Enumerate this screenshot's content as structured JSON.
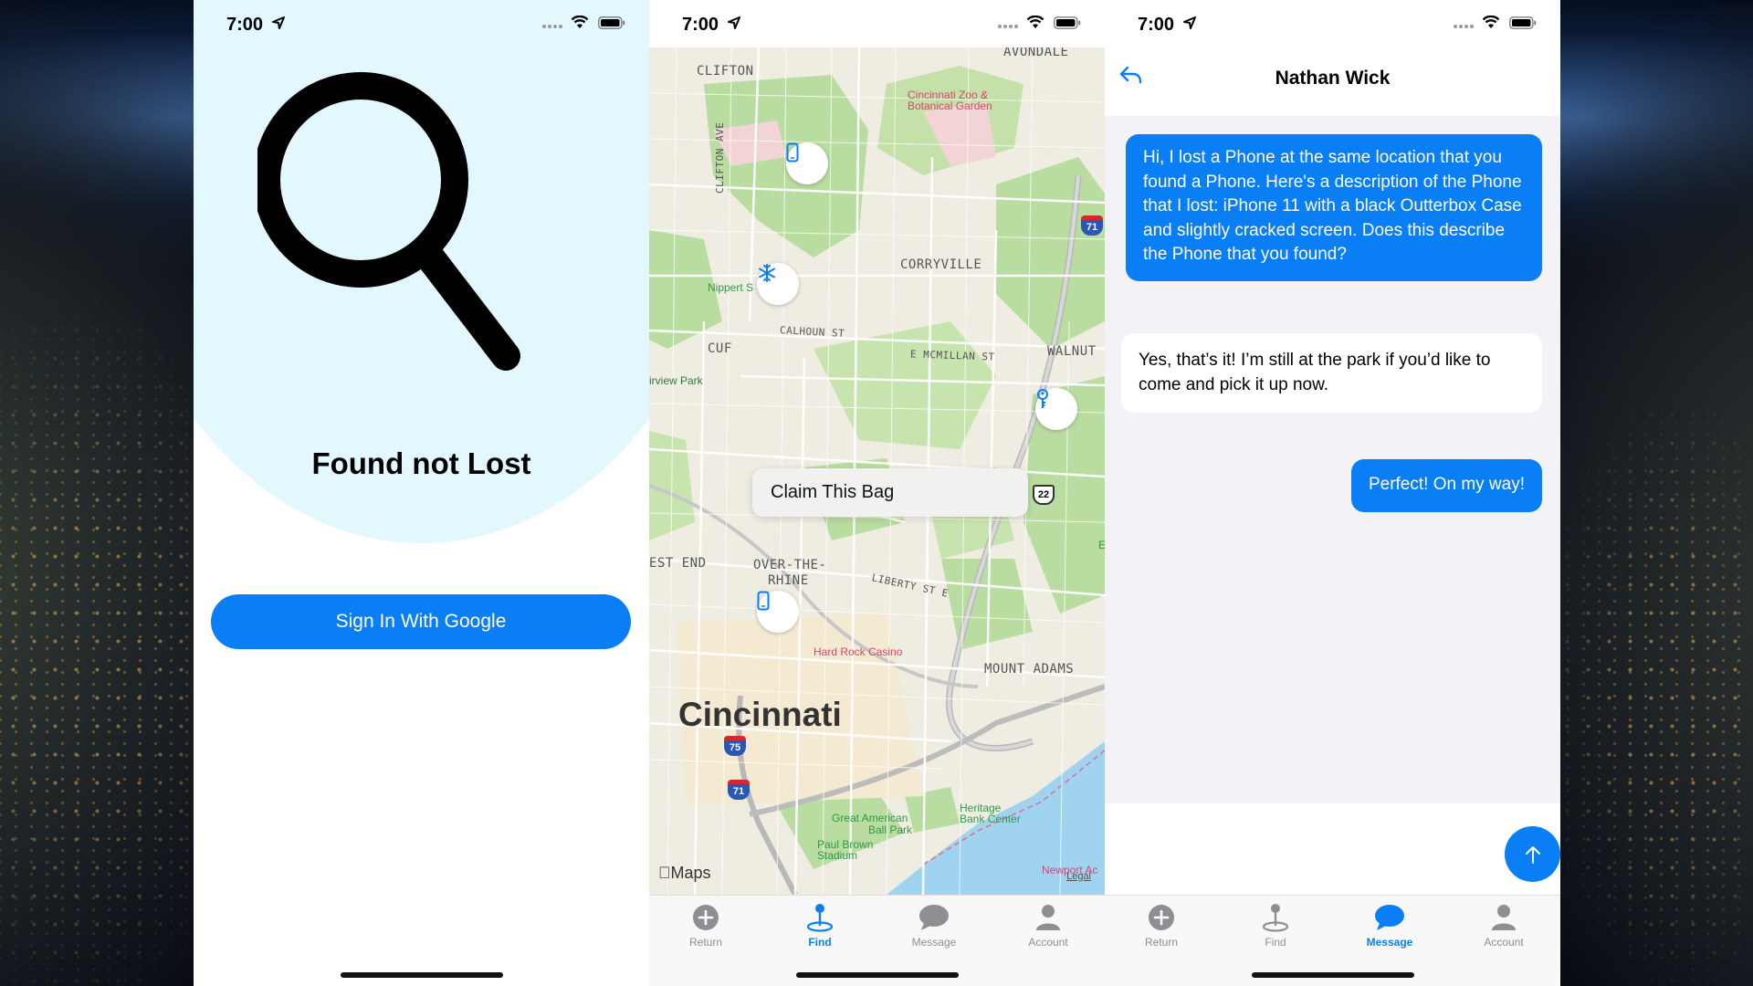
{
  "status_bar": {
    "time": "7:00"
  },
  "screen1": {
    "title": "Found not Lost",
    "google_button": "Sign In With Google",
    "colors": {
      "accent": "#0a7ff5",
      "hero_circle": "#e3f8fd"
    }
  },
  "screen2": {
    "popup": "Claim This Bag",
    "city": "Cincinnati",
    "maps_brand": "Maps",
    "legal": "Legal",
    "neighborhoods": {
      "avondale": "AVONDALE",
      "clifton": "CLIFTON",
      "corryville": "CORRYVILLE",
      "cuf": "CUF",
      "walnut": "WALNUT H",
      "west_end": "EST END",
      "otr": "OVER-THE-",
      "otr2": "RHINE",
      "mount_adams": "MOUNT ADAMS"
    },
    "streets": {
      "clifton_ave": "CLIFTON AVE",
      "calhoun": "CALHOUN ST",
      "mcmillan": "E MCMILLAN ST",
      "liberty": "LIBERTY ST E"
    },
    "pois": {
      "zoo": "Cincinnati Zoo &",
      "zoo2": "Botanical Garden",
      "nippert": "Nippert S",
      "fairview": "irview Park",
      "hard_rock": "Hard Rock Casino",
      "gabp": "Great American",
      "gabp2": "Ball Park",
      "heritage": "Heritage",
      "heritage2": "Bank Center",
      "paul_brown": "Paul Brown",
      "paul_brown2": "Stadium",
      "newport": "Newport Ac",
      "e_marker": "E"
    },
    "shields": {
      "i71_top": "71",
      "i75": "75",
      "i71_bottom": "71",
      "us22": "22"
    },
    "pins": [
      "phone-icon",
      "snowflake-icon",
      "key-icon",
      "phone-icon"
    ]
  },
  "screen3": {
    "contact_name": "Nathan Wick",
    "messages": [
      {
        "direction": "outgoing",
        "text": "Hi, I lost a Phone at the same location that you found a Phone. Here's a description of the Phone that I lost: iPhone 11 with a black Outterbox Case and slightly cracked screen. Does this describe the Phone that you found?"
      },
      {
        "direction": "incoming",
        "text": "Yes, that’s it! I’m still at the park if you’d like to come and pick it up now."
      },
      {
        "direction": "outgoing",
        "text": "Perfect! On my way!"
      }
    ]
  },
  "tabs": [
    {
      "label": "Return",
      "icon": "plus-circle-icon"
    },
    {
      "label": "Find",
      "icon": "map-pin-icon"
    },
    {
      "label": "Message",
      "icon": "chat-bubble-icon"
    },
    {
      "label": "Account",
      "icon": "person-icon"
    }
  ],
  "active_tab": {
    "screen2": "Find",
    "screen3": "Message"
  }
}
